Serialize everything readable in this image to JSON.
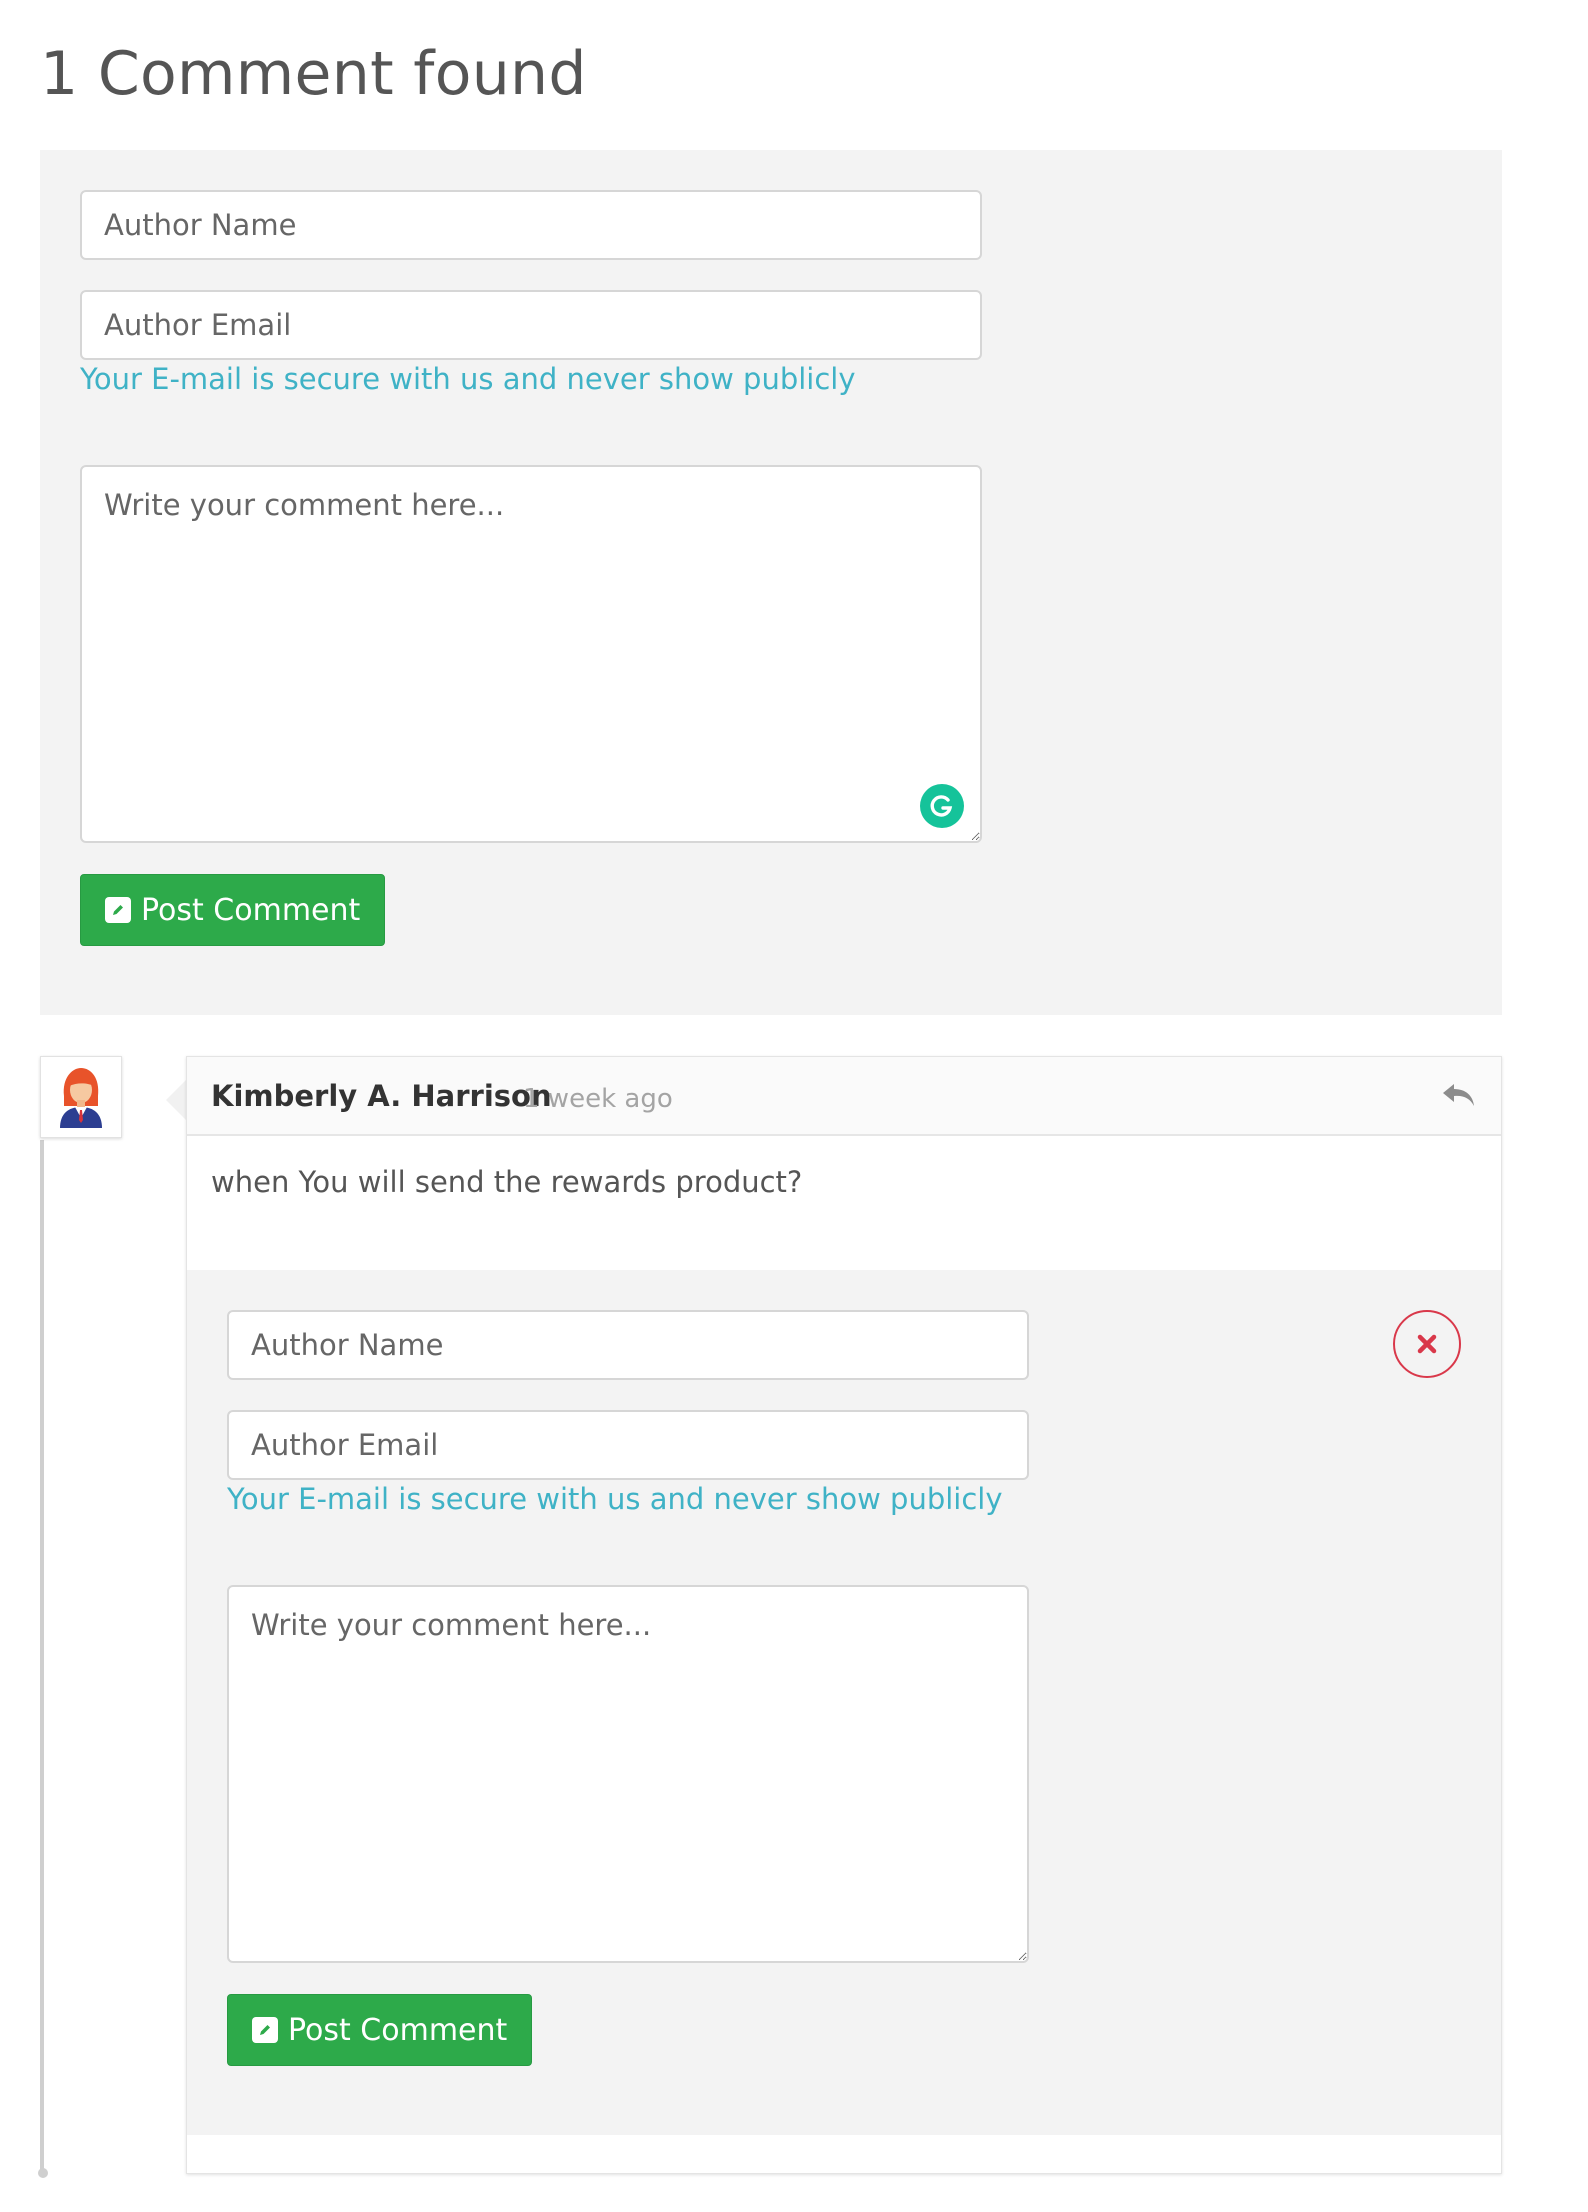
{
  "page": {
    "title": "1 Comment found"
  },
  "comment_form": {
    "name_placeholder": "Author Name",
    "email_placeholder": "Author Email",
    "email_help": "Your E-mail is secure with us and never show publicly",
    "comment_placeholder": "Write your comment here...",
    "submit_label": "Post Comment",
    "submit_icon": "pencil-square-icon",
    "extension_icon": "grammarly-icon"
  },
  "comments": [
    {
      "author": "Kimberly A. Harrison",
      "time": "1 week ago",
      "body": "when You will send the rewards product?",
      "avatar_icon": "woman-avatar-icon",
      "reply_icon": "reply-arrow-icon",
      "reply_form": {
        "name_placeholder": "Author Name",
        "email_placeholder": "Author Email",
        "email_help": "Your E-mail is secure with us and never show publicly",
        "comment_placeholder": "Write your comment here...",
        "submit_label": "Post Comment",
        "close_icon": "close-x-icon"
      }
    }
  ],
  "colors": {
    "accent_green": "#2daa4a",
    "help_text_cyan": "#3fb2c6",
    "close_red": "#d9384a",
    "panel_gray": "#f3f3f3",
    "grammarly_green": "#15c39a"
  }
}
